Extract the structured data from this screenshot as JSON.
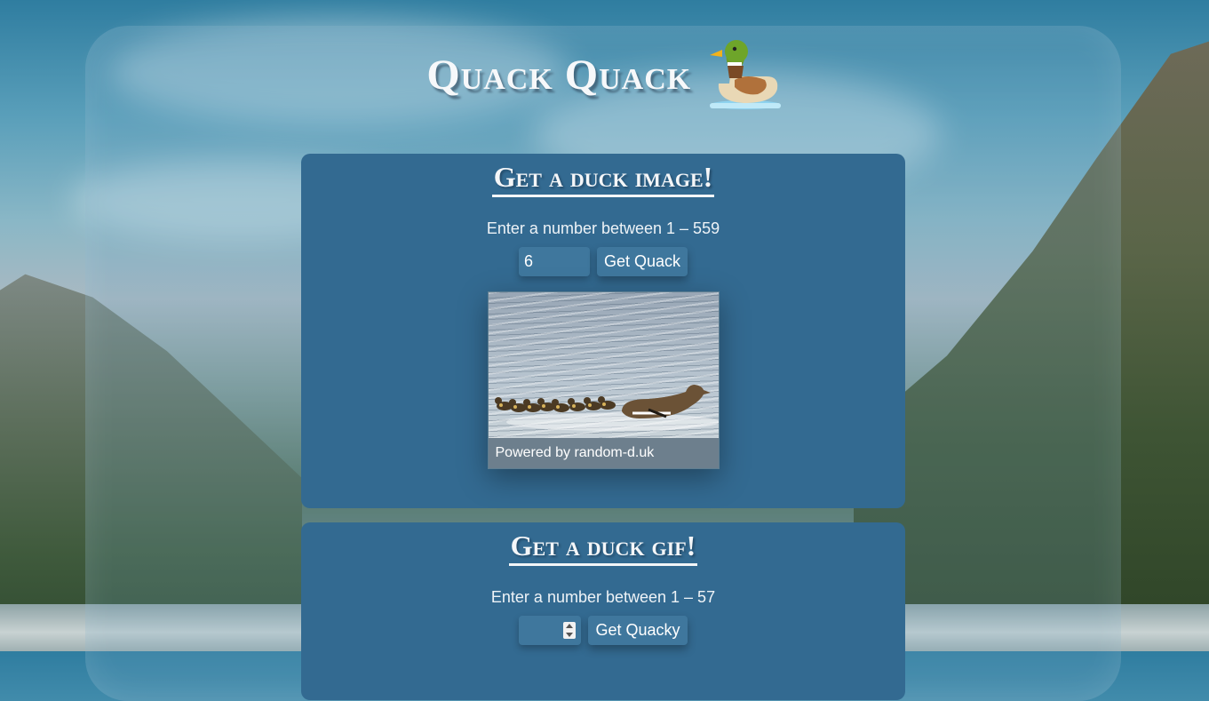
{
  "header": {
    "title": "Quack Quack",
    "logo_icon": "duck-icon"
  },
  "image_section": {
    "heading": "Get a duck image!",
    "prompt": "Enter a number between 1 – 559",
    "input_value": "6",
    "button_label": "Get Quack",
    "photo_icon": "duck-family-photo",
    "caption": "Powered by random-d.uk"
  },
  "gif_section": {
    "heading": "Get a duck gif!",
    "prompt": "Enter a number between 1 – 57",
    "input_value": "",
    "button_label": "Get Quacky"
  },
  "colors": {
    "card": "#336a91",
    "button": "#3f779d",
    "text": "#ffffff"
  }
}
